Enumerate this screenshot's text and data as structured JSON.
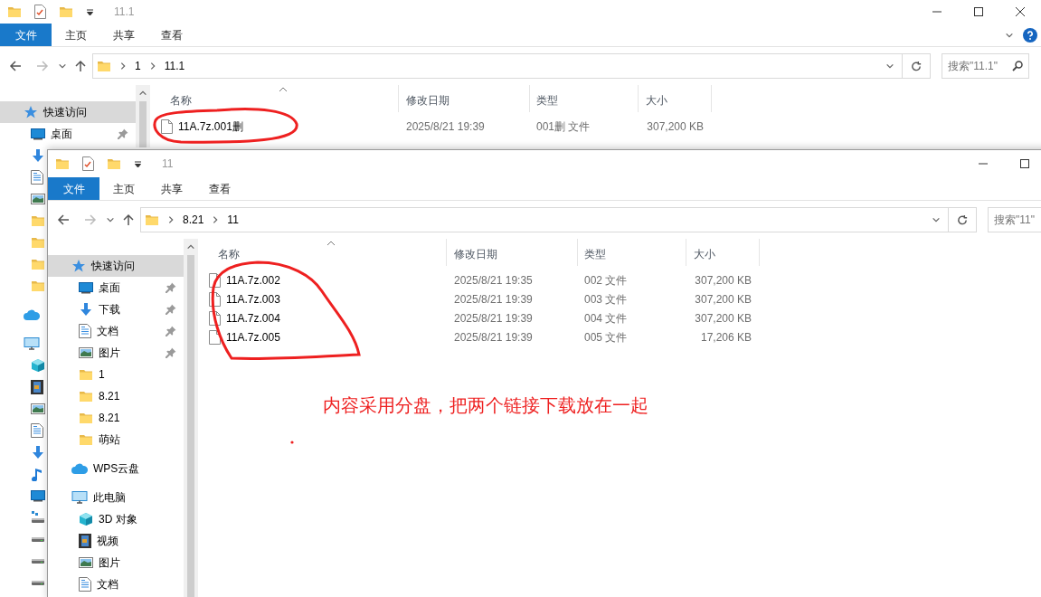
{
  "back_window": {
    "title": "11.1",
    "ribbon_tabs": [
      {
        "label": "文件",
        "selected": true
      },
      {
        "label": "主页",
        "selected": false
      },
      {
        "label": "共享",
        "selected": false
      },
      {
        "label": "查看",
        "selected": false
      }
    ],
    "address": [
      "1",
      "11.1"
    ],
    "search": {
      "placeholder": "搜索\"11.1\""
    },
    "nav": [
      {
        "kind": "star",
        "label": "快速访问",
        "selected": true,
        "pinned": false,
        "children": [
          {
            "kind": "desktop",
            "label": "桌面",
            "selected": false,
            "pinned": true
          },
          {
            "kind": "download",
            "selected": false,
            "pinned": false
          },
          {
            "kind": "document",
            "selected": false,
            "pinned": false
          },
          {
            "kind": "picture",
            "selected": false,
            "pinned": false
          },
          {
            "kind": "folder",
            "selected": false,
            "pinned": false
          },
          {
            "kind": "folder",
            "selected": false,
            "pinned": false
          },
          {
            "kind": "folder",
            "selected": false,
            "pinned": false
          },
          {
            "kind": "folder",
            "selected": false,
            "pinned": false
          }
        ]
      },
      {
        "kind": "cloud",
        "selected": false,
        "pinned": false
      },
      {
        "kind": "pc",
        "selected": false,
        "pinned": false,
        "children": [
          {
            "kind": "cube",
            "selected": false,
            "pinned": false
          },
          {
            "kind": "video",
            "selected": false,
            "pinned": false
          },
          {
            "kind": "picture",
            "selected": false,
            "pinned": false
          },
          {
            "kind": "document",
            "selected": false,
            "pinned": false
          },
          {
            "kind": "download",
            "selected": false,
            "pinned": false
          },
          {
            "kind": "music",
            "selected": false,
            "pinned": false
          },
          {
            "kind": "desktop",
            "selected": false,
            "pinned": false
          },
          {
            "kind": "netdrive",
            "selected": false,
            "pinned": false
          },
          {
            "kind": "drive",
            "selected": false,
            "pinned": false
          },
          {
            "kind": "drive",
            "selected": false,
            "pinned": false
          },
          {
            "kind": "drive",
            "selected": false,
            "pinned": false
          }
        ]
      }
    ],
    "columns": [
      "名称",
      "修改日期",
      "类型",
      "大小"
    ],
    "files": [
      {
        "name": "11A.7z.001删",
        "modified": "2025/8/21 19:39",
        "type": "001删 文件",
        "size": "307,200 KB"
      }
    ]
  },
  "front_window": {
    "title": "11",
    "ribbon_tabs": [
      {
        "label": "文件",
        "selected": true
      },
      {
        "label": "主页",
        "selected": false
      },
      {
        "label": "共享",
        "selected": false
      },
      {
        "label": "查看",
        "selected": false
      }
    ],
    "address": [
      "8.21",
      "11"
    ],
    "search": {
      "placeholder": "搜索\"11\""
    },
    "nav": [
      {
        "kind": "star",
        "label": "快速访问",
        "selected": true,
        "pinned": false,
        "children": [
          {
            "kind": "desktop",
            "label": "桌面",
            "selected": false,
            "pinned": true
          },
          {
            "kind": "download",
            "label": "下载",
            "selected": false,
            "pinned": true
          },
          {
            "kind": "document",
            "label": "文档",
            "selected": false,
            "pinned": true
          },
          {
            "kind": "picture",
            "label": "图片",
            "selected": false,
            "pinned": true
          },
          {
            "kind": "folder",
            "label": "1",
            "selected": false,
            "pinned": false
          },
          {
            "kind": "folder",
            "label": "8.21",
            "selected": false,
            "pinned": false
          },
          {
            "kind": "folder",
            "label": "8.21",
            "selected": false,
            "pinned": false
          },
          {
            "kind": "folder",
            "label": "萌站",
            "selected": false,
            "pinned": false
          }
        ]
      },
      {
        "kind": "cloud",
        "label": "WPS云盘",
        "selected": false,
        "pinned": false
      },
      {
        "kind": "pc",
        "label": "此电脑",
        "selected": false,
        "pinned": false,
        "children": [
          {
            "kind": "cube",
            "label": "3D 对象",
            "selected": false,
            "pinned": false
          },
          {
            "kind": "video",
            "label": "视频",
            "selected": false,
            "pinned": false
          },
          {
            "kind": "picture",
            "label": "图片",
            "selected": false,
            "pinned": false
          },
          {
            "kind": "document",
            "label": "文档",
            "selected": false,
            "pinned": false
          }
        ]
      }
    ],
    "columns": [
      "名称",
      "修改日期",
      "类型",
      "大小"
    ],
    "files": [
      {
        "name": "11A.7z.002",
        "modified": "2025/8/21 19:35",
        "type": "002 文件",
        "size": "307,200 KB"
      },
      {
        "name": "11A.7z.003",
        "modified": "2025/8/21 19:39",
        "type": "003 文件",
        "size": "307,200 KB"
      },
      {
        "name": "11A.7z.004",
        "modified": "2025/8/21 19:39",
        "type": "004 文件",
        "size": "307,200 KB"
      },
      {
        "name": "11A.7z.005",
        "modified": "2025/8/21 19:39",
        "type": "005 文件",
        "size": "17,206 KB"
      }
    ]
  },
  "annotation": {
    "text": "内容采用分盘，把两个链接下载放在一起"
  }
}
